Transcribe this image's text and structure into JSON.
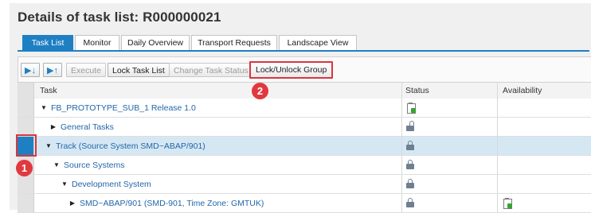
{
  "page": {
    "title": "Details of task list: R000000021"
  },
  "tabs": [
    {
      "label": "Task List",
      "active": true
    },
    {
      "label": "Monitor"
    },
    {
      "label": "Daily Overview"
    },
    {
      "label": "Transport Requests"
    },
    {
      "label": "Landscape View"
    }
  ],
  "toolbar": {
    "sort_ascending_icon": "sort-ascending-icon",
    "sort_descending_icon": "sort-descending-icon",
    "execute": "Execute",
    "lock_task_list": "Lock Task List",
    "change_task_status": "Change Task Status",
    "lock_unlock_group": "Lock/Unlock Group"
  },
  "columns": {
    "task": "Task",
    "status": "Status",
    "availability": "Availability"
  },
  "rows": [
    {
      "task": "FB_PROTOTYPE_SUB_1 Release 1.0",
      "expanded": true,
      "status_icon": "clipboard-status-icon"
    },
    {
      "task": "General Tasks",
      "expanded": false,
      "status_icon": "unlocked-icon"
    },
    {
      "task": "Track (Source System SMD~ABAP/901)",
      "expanded": true,
      "status_icon": "lock-icon",
      "selected": true
    },
    {
      "task": "Source Systems",
      "expanded": true,
      "status_icon": "lock-icon"
    },
    {
      "task": "Development System",
      "expanded": true,
      "status_icon": "lock-icon"
    },
    {
      "task": "SMD~ABAP/901 (SMD-901, Time Zone: GMTUK)",
      "expanded": false,
      "status_icon": "lock-icon",
      "availability_icon": "available-status-icon"
    }
  ],
  "callouts": {
    "first": "1",
    "second": "2"
  },
  "colors": {
    "accent": "#1e7fc3",
    "highlight_red": "#d9363e",
    "selected_row": "#d6e7f4"
  }
}
